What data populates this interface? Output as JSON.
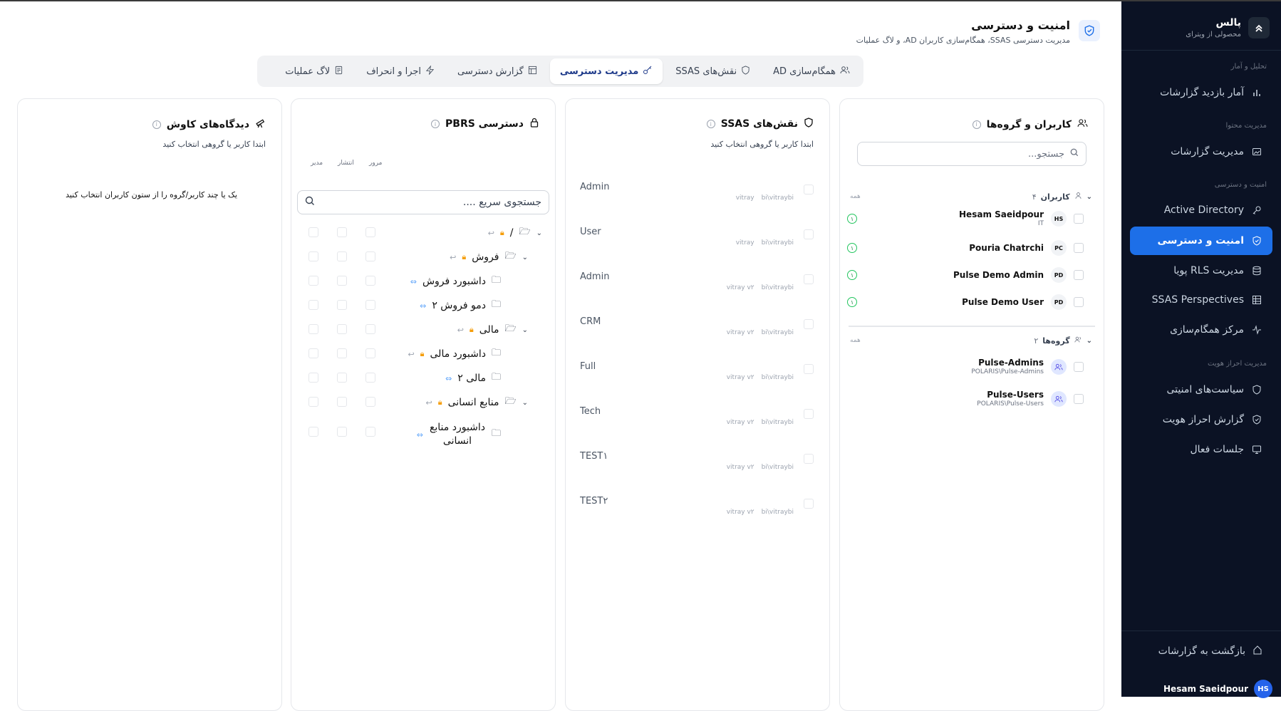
{
  "sidebar": {
    "brand_name": "پالس",
    "brand_sub": "محصولی از ویترای",
    "sections": {
      "analytics": "تحلیل و آمار",
      "content": "مدیریت محتوا",
      "security": "امنیت و دسترسی",
      "auth": "مدیریت احراز هویت"
    },
    "items": [
      {
        "label": "آمار بازدید گزارشات",
        "icon": "bar-chart-icon"
      },
      {
        "label": "مدیریت گزارشات",
        "icon": "image-icon"
      },
      {
        "label": "Active Directory",
        "icon": "key-icon"
      },
      {
        "label": "امنیت و دسترسی",
        "icon": "shield-check-icon",
        "active": true
      },
      {
        "label": "مدیریت RLS پویا",
        "icon": "database-icon"
      },
      {
        "label": "SSAS Perspectives",
        "icon": "grid-icon"
      },
      {
        "label": "مرکز همگام‌سازی",
        "icon": "activity-icon"
      },
      {
        "label": "سیاست‌های امنیتی",
        "icon": "shield-icon"
      },
      {
        "label": "گزارش احراز هویت",
        "icon": "shield-check-icon"
      },
      {
        "label": "جلسات فعال",
        "icon": "monitor-icon"
      }
    ],
    "back_label": "بازگشت به گزارشات",
    "user_name": "Hesam Saeidpour",
    "user_initials": "HS"
  },
  "header": {
    "title": "امنیت و دسترسی",
    "subtitle": "مدیریت دسترسی SSAS، همگام‌سازی کاربران AD، و لاگ عملیات"
  },
  "tabs": [
    {
      "label": "همگام‌سازی AD",
      "active": false
    },
    {
      "label": "نقش‌های SSAS",
      "active": false
    },
    {
      "label": "مدیریت دسترسی",
      "active": true
    },
    {
      "label": "گزارش دسترسی",
      "active": false
    },
    {
      "label": "اجرا و انحراف",
      "active": false
    },
    {
      "label": "لاگ عملیات",
      "active": false
    }
  ],
  "users_panel": {
    "title": "کاربران و گروه‌ها",
    "search_placeholder": "جستجو...",
    "users_header": "کاربران",
    "users_count": "۴",
    "all_label": "همه",
    "users": [
      {
        "name": "Hesam Saeidpour",
        "sub": "IT",
        "initials": "HS",
        "badge": "۱"
      },
      {
        "name": "Pouria Chatrchi",
        "sub": "",
        "initials": "PC",
        "badge": "۱"
      },
      {
        "name": "Pulse Demo Admin",
        "sub": "",
        "initials": "PD",
        "badge": "۱"
      },
      {
        "name": "Pulse Demo User",
        "sub": "",
        "initials": "PD",
        "badge": "۱"
      }
    ],
    "groups_header": "گروه‌ها",
    "groups_count": "۲",
    "groups": [
      {
        "name": "Pulse-Admins",
        "sub": "POLARIS\\Pulse-Admins"
      },
      {
        "name": "Pulse-Users",
        "sub": "POLARIS\\Pulse-Users"
      }
    ]
  },
  "ssas_panel": {
    "title": "نقش‌های SSAS",
    "hint": "ابتدا کاربر یا گروهی انتخاب کنید",
    "roles": [
      {
        "name": "Admin",
        "server": "bi\\vitraybi",
        "db": "vitray"
      },
      {
        "name": "User",
        "server": "bi\\vitraybi",
        "db": "vitray"
      },
      {
        "name": "Admin",
        "server": "bi\\vitraybi",
        "db": "vitray v۲"
      },
      {
        "name": "CRM",
        "server": "bi\\vitraybi",
        "db": "vitray v۲"
      },
      {
        "name": "Full",
        "server": "bi\\vitraybi",
        "db": "vitray v۲"
      },
      {
        "name": "Tech",
        "server": "bi\\vitraybi",
        "db": "vitray v۲"
      },
      {
        "name": "TEST۱",
        "server": "bi\\vitraybi",
        "db": "vitray v۲"
      },
      {
        "name": "TEST۲",
        "server": "bi\\vitraybi",
        "db": "vitray v۲"
      }
    ]
  },
  "pbrs_panel": {
    "title": "دسترسی PBRS",
    "hint": "ابتدا کاربر یا گروهی انتخاب کنید",
    "col_view": "مرور",
    "col_publish": "انتشار",
    "col_admin": "مدیر",
    "search_placeholder": "جستجوی سریع ....",
    "tree": [
      {
        "label": "/",
        "type": "folder-open",
        "lock": true,
        "level": 0
      },
      {
        "label": "فروش",
        "type": "folder-open",
        "lock": true,
        "level": 1
      },
      {
        "label": "داشبورد فروش",
        "type": "folder",
        "link": true,
        "level": 2
      },
      {
        "label": "دمو فروش ۲",
        "type": "folder",
        "link": true,
        "level": 2
      },
      {
        "label": "مالی",
        "type": "folder-open",
        "lock": true,
        "level": 1
      },
      {
        "label": "داشبورد مالی",
        "type": "folder",
        "lock": true,
        "level": 2
      },
      {
        "label": "مالی ۲",
        "type": "folder",
        "link": true,
        "level": 2
      },
      {
        "label": "منابع انسانی",
        "type": "folder-open",
        "lock": true,
        "level": 1
      },
      {
        "label": "داشبورد منابع انسانی",
        "type": "folder",
        "link": true,
        "level": 2
      }
    ]
  },
  "discovery_panel": {
    "title": "دیدگاه‌های کاوش",
    "hint": "ابتدا کاربر یا گروهی انتخاب کنید",
    "empty": "یک یا چند کاربر/گروه را از ستون کاربران انتخاب کنید"
  },
  "colors": {
    "accent": "#1d6fe8",
    "sidebar_bg": "#0b1224",
    "lock": "#f59e0b",
    "badge": "#22c55e"
  }
}
